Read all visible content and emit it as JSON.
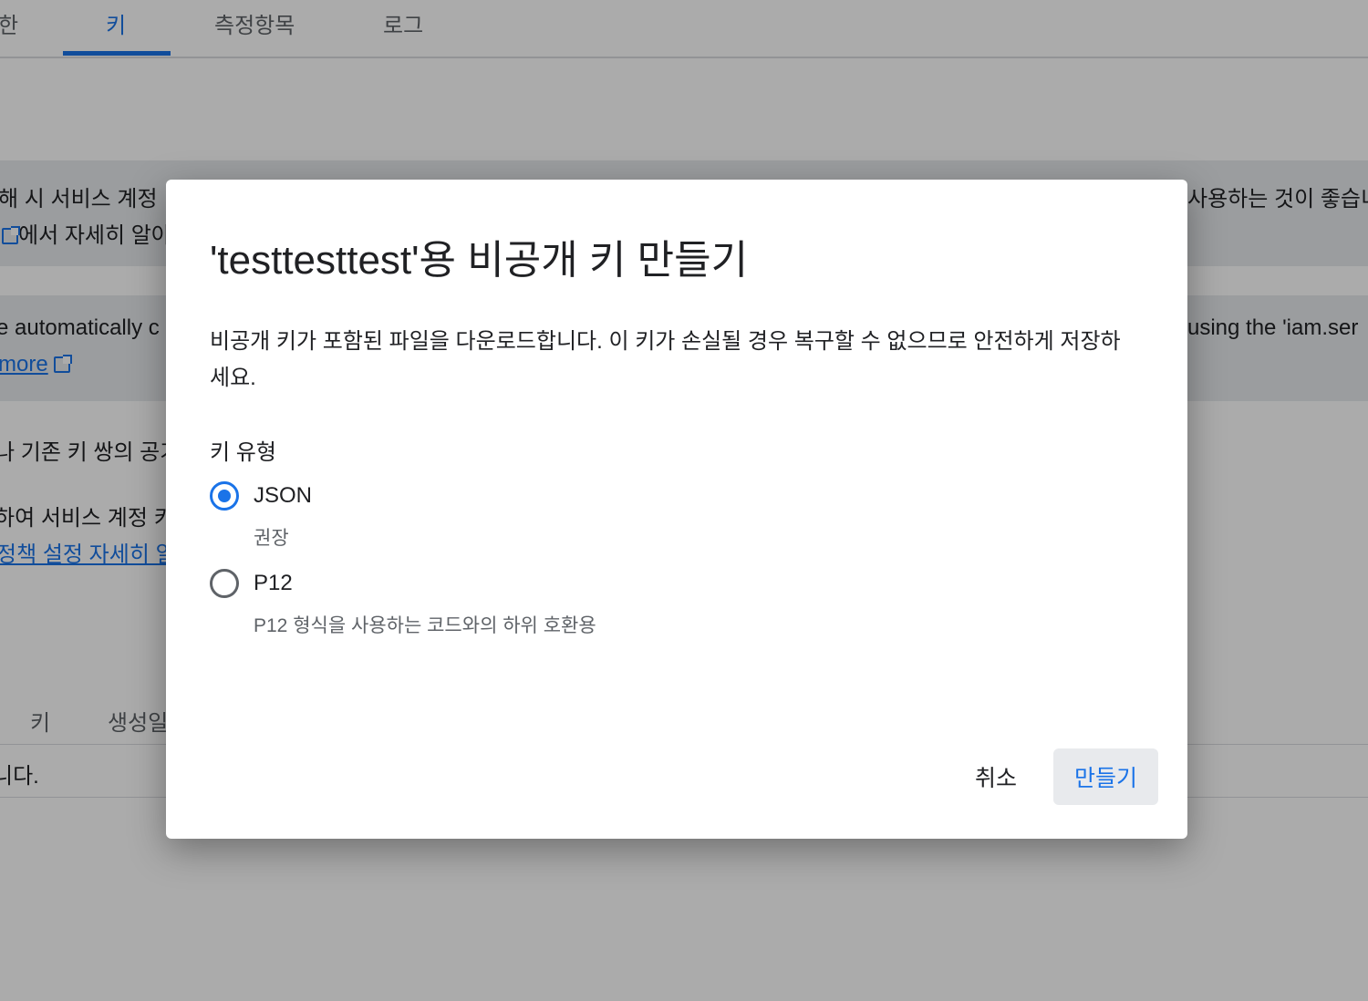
{
  "background": {
    "tabs": [
      {
        "label": "한",
        "active": false
      },
      {
        "label": "키",
        "active": true
      },
      {
        "label": "측정항목",
        "active": false
      },
      {
        "label": "로그",
        "active": false
      }
    ],
    "banner1": {
      "left_line1": "해 시 서비스 계정",
      "left_line2": "에서 자세히 알아",
      "right_line1": "사용하는 것이 좋습니"
    },
    "banner2": {
      "left_line1": "e automatically c",
      "left_link": "more",
      "right_line1": "using the 'iam.ser"
    },
    "body_texts": {
      "line1": "나 기존 키 쌍의 공기",
      "line2": "하여 서비스 계정 키",
      "line3_link": "정책 설정 자세히 알"
    },
    "table": {
      "col_key": "키",
      "col_created": "생성일",
      "empty_row": "니다."
    }
  },
  "dialog": {
    "title": "'testtesttest'용 비공개 키 만들기",
    "description": "비공개 키가 포함된 파일을 다운로드합니다. 이 키가 손실될 경우 복구할 수 없으므로 안전하게 저장하세요.",
    "key_type_label": "키 유형",
    "options": [
      {
        "label": "JSON",
        "sub": "권장",
        "checked": true
      },
      {
        "label": "P12",
        "sub": "P12 형식을 사용하는 코드와의 하위 호환용",
        "checked": false
      }
    ],
    "cancel_label": "취소",
    "create_label": "만들기"
  },
  "colors": {
    "accent": "#1a73e8",
    "overlay": "rgba(0,0,0,0.33)"
  }
}
